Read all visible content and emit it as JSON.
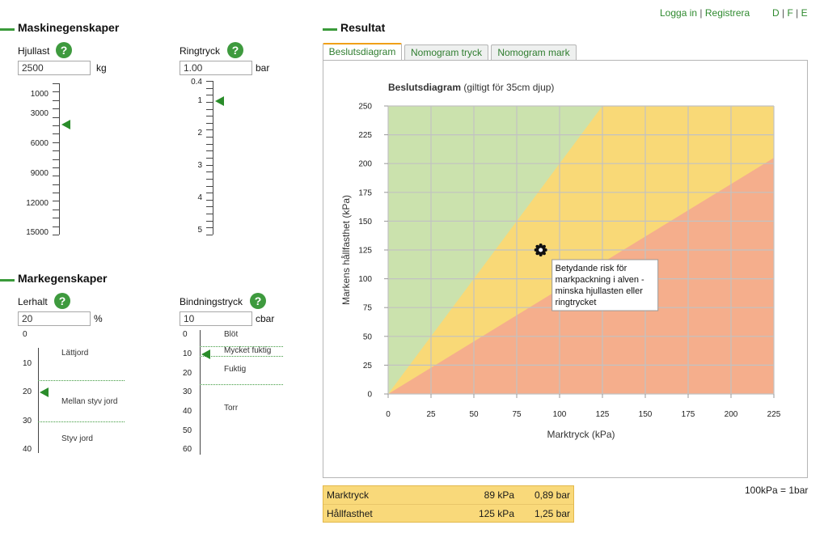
{
  "topnav": {
    "login": "Logga in",
    "separator": "|",
    "register": "Registrera",
    "lang_d": "D",
    "lang_f": "F",
    "lang_e": "E"
  },
  "machine": {
    "title": "Maskinegenskaper",
    "wheel_load": {
      "label": "Hjullast",
      "help": "?",
      "value": "2500",
      "unit": "kg",
      "scale_labels": [
        "1000",
        "3000",
        "6000",
        "9000",
        "12000",
        "15000"
      ],
      "current": 2500
    },
    "tire_pressure": {
      "label": "Ringtryck",
      "help": "?",
      "value": "1.00",
      "unit": "bar",
      "scale_labels": [
        "0.4",
        "1",
        "2",
        "3",
        "4",
        "5"
      ],
      "current": 1.0
    }
  },
  "soil": {
    "title": "Markegenskaper",
    "clay": {
      "label": "Lerhalt",
      "help": "?",
      "value": "20",
      "unit": "%",
      "scale_labels": [
        "0",
        "10",
        "20",
        "30",
        "40"
      ],
      "zones": [
        "Lättjord",
        "Mellan styv jord",
        "Styv jord"
      ],
      "current": 20
    },
    "binding": {
      "label": "Bindningstryck",
      "help": "?",
      "value": "10",
      "unit": "cbar",
      "scale_labels": [
        "0",
        "10",
        "20",
        "30",
        "40",
        "50",
        "60"
      ],
      "zones": [
        "Blöt",
        "Mycket fuktig",
        "Fuktig",
        "Torr"
      ],
      "current": 10
    }
  },
  "result": {
    "title": "Resultat",
    "tabs": [
      "Beslutsdiagram",
      "Nomogram tryck",
      "Nomogram mark"
    ],
    "active_tab": 0,
    "conversion_note": "100kPa = 1bar",
    "rows": [
      {
        "label": "Marktryck",
        "kpa": "89 kPa",
        "bar": "0,89 bar"
      },
      {
        "label": "Hållfasthet",
        "kpa": "125 kPa",
        "bar": "1,25 bar"
      }
    ]
  },
  "colors": {
    "accent_green": "#3a9a3a",
    "zone_green": "#cbe2ad",
    "zone_yellow": "#f9d977",
    "zone_red": "#f5ae8c",
    "result_bg": "#f9d97a"
  },
  "chart_data": {
    "type": "scatter",
    "title": "Beslutsdiagram",
    "subtitle": "(giltigt för 35cm djup)",
    "xlabel": "Marktryck (kPa)",
    "ylabel": "Markens hållfasthet (kPa)",
    "xlim": [
      0,
      225
    ],
    "ylim": [
      0,
      250
    ],
    "x_ticks": [
      0,
      25,
      50,
      75,
      100,
      125,
      150,
      175,
      200,
      225
    ],
    "y_ticks": [
      0,
      25,
      50,
      75,
      100,
      125,
      150,
      175,
      200,
      225,
      250
    ],
    "grid": true,
    "zones": [
      {
        "color": "#cbe2ad",
        "upper_boundary": [
          [
            0,
            0
          ],
          [
            125,
            250
          ]
        ]
      },
      {
        "color": "#f9d977",
        "lower_boundary": [
          [
            0,
            0
          ],
          [
            225,
            205
          ]
        ]
      },
      {
        "color": "#f5ae8c"
      }
    ],
    "point": {
      "x": 89,
      "y": 125
    },
    "annotation": [
      "Betydande risk för",
      "markpackning i alven -",
      "minska hjullasten eller",
      "ringtrycket"
    ]
  }
}
